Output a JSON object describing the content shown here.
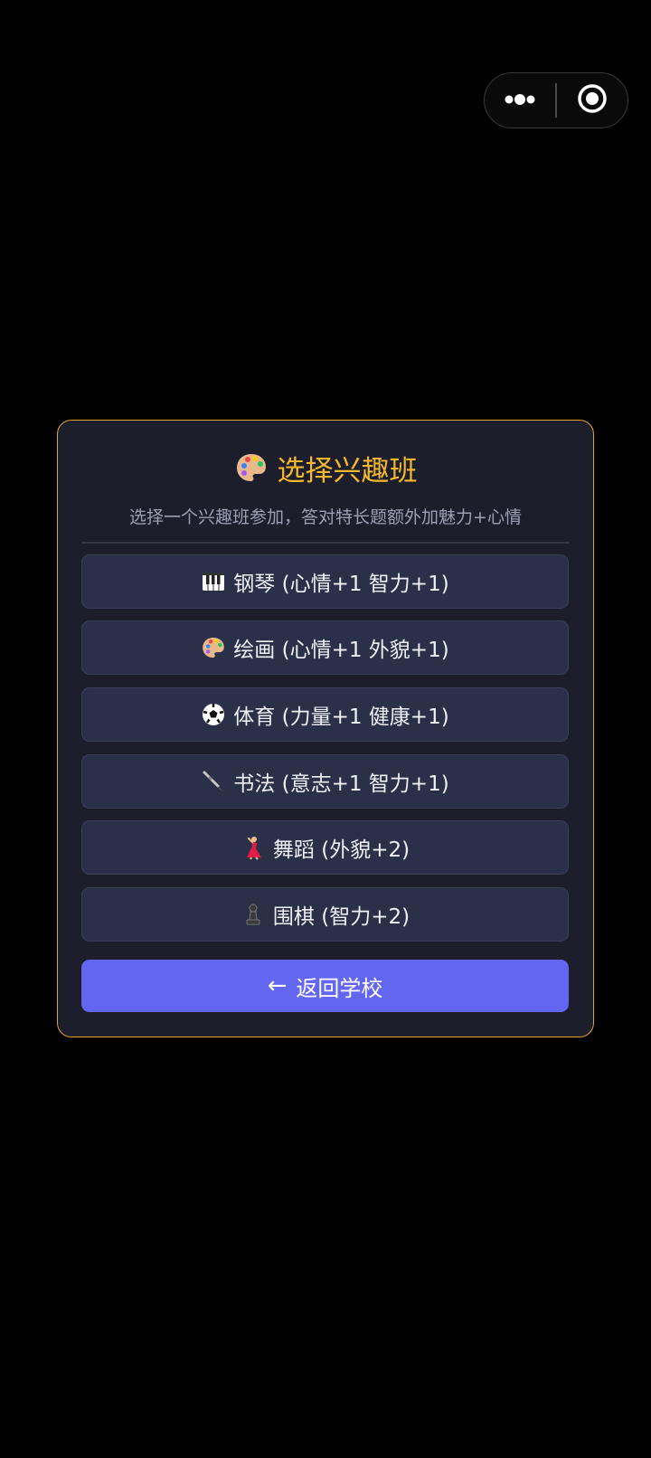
{
  "capsule": {
    "more_icon": "more-dots-icon",
    "close_icon": "target-circle-icon"
  },
  "dialog": {
    "title_icon": "palette-icon",
    "title": "选择兴趣班",
    "subtitle": "选择一个兴趣班参加，答对特长题额外加魅力+心情",
    "options": [
      {
        "icon": "piano-keys-icon",
        "label": "钢琴 (心情+1 智力+1)"
      },
      {
        "icon": "palette-icon",
        "label": "绘画 (心情+1 外貌+1)"
      },
      {
        "icon": "soccer-ball-icon",
        "label": "体育 (力量+1 健康+1)"
      },
      {
        "icon": "calligraphy-brush-icon",
        "label": "书法 (意志+1 智力+1)"
      },
      {
        "icon": "dancer-icon",
        "label": "舞蹈 (外貌+2)"
      },
      {
        "icon": "chess-pawn-icon",
        "label": "围棋 (智力+2)"
      }
    ],
    "back_arrow": "←",
    "back_label": "返回学校"
  },
  "colors": {
    "accent_border": "#e3a32a",
    "title_color": "#f5b82c",
    "card_bg": "#1c1e2c",
    "option_bg": "#2b3049",
    "back_button_bg": "#6366f1"
  }
}
